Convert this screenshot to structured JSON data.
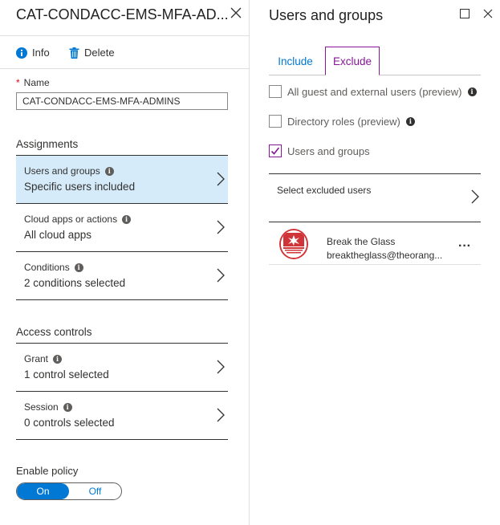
{
  "left_blade": {
    "title": "CAT-CONDACC-EMS-MFA-AD...",
    "commands": {
      "info_label": "Info",
      "delete_label": "Delete"
    },
    "name_field": {
      "required_mark": "*",
      "label": "Name",
      "value": "CAT-CONDACC-EMS-MFA-ADMINS"
    },
    "assignments": {
      "heading": "Assignments",
      "items": [
        {
          "label": "Users and groups",
          "value": "Specific users included"
        },
        {
          "label": "Cloud apps or actions",
          "value": "All cloud apps"
        },
        {
          "label": "Conditions",
          "value": "2 conditions selected"
        }
      ]
    },
    "access_controls": {
      "heading": "Access controls",
      "items": [
        {
          "label": "Grant",
          "value": "1 control selected"
        },
        {
          "label": "Session",
          "value": "0 controls selected"
        }
      ]
    },
    "enable_policy": {
      "label": "Enable policy",
      "on_label": "On",
      "off_label": "Off",
      "selected": "On"
    }
  },
  "right_blade": {
    "title": "Users and groups",
    "tabs": [
      {
        "label": "Include"
      },
      {
        "label": "Exclude"
      }
    ],
    "selected_tab": "Exclude",
    "options": [
      {
        "label": "All guest and external users (preview)",
        "checked": false
      },
      {
        "label": "Directory roles (preview)",
        "checked": false
      },
      {
        "label": "Users and groups",
        "checked": true
      }
    ],
    "select_label": "Select excluded users",
    "members": [
      {
        "name": "Break the Glass",
        "email": "breaktheglass@theorang..."
      }
    ],
    "more_label": "···"
  },
  "colors": {
    "accent_blue": "#0078d4",
    "exclude_purple": "#881798",
    "active_nav_bg": "#d6ebfa",
    "required_red": "#e00b1c"
  },
  "icons": [
    "close-icon",
    "info-circle-icon",
    "trash-icon",
    "chevron-right-icon",
    "maximize-icon",
    "checkmark-icon",
    "more-icon"
  ]
}
